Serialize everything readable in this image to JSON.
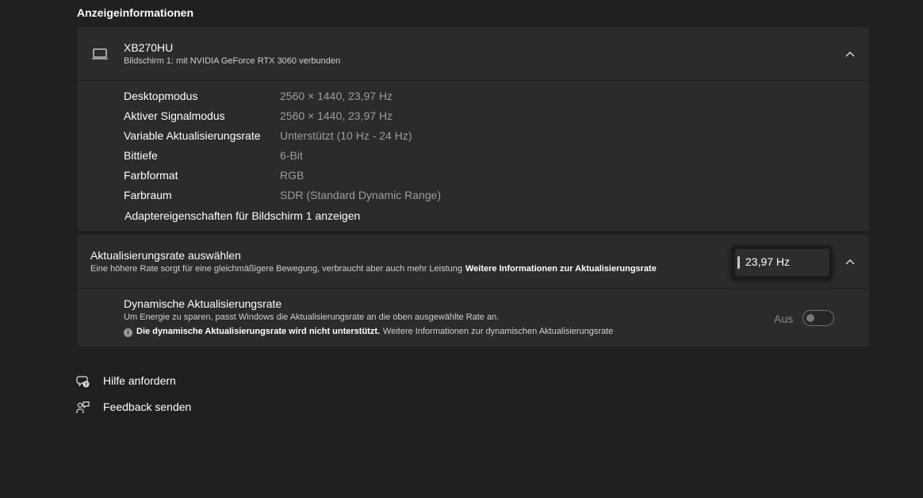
{
  "section_title": "Anzeigeinformationen",
  "display": {
    "name": "XB270HU",
    "subtitle": "Bildschirm 1: mit NVIDIA GeForce RTX 3060 verbunden",
    "icon": "laptop-icon",
    "expanded": true,
    "rows": [
      {
        "label": "Desktopmodus",
        "value": "2560 × 1440, 23,97 Hz"
      },
      {
        "label": "Aktiver Signalmodus",
        "value": "2560 × 1440, 23,97 Hz"
      },
      {
        "label": "Variable Aktualisierungsrate",
        "value": "Unterstützt (10 Hz - 24 Hz)"
      },
      {
        "label": "Bittiefe",
        "value": "6-Bit"
      },
      {
        "label": "Farbformat",
        "value": "RGB"
      },
      {
        "label": "Farbraum",
        "value": "SDR (Standard Dynamic Range)"
      }
    ],
    "adapter_link": "Adaptereigenschaften für Bildschirm 1 anzeigen"
  },
  "refresh_rate": {
    "title": "Aktualisierungsrate auswählen",
    "description": "Eine höhere Rate sorgt für eine gleichmäßigere Bewegung, verbraucht aber auch mehr Leistung",
    "more_info_link": "Weitere Informationen zur Aktualisierungsrate",
    "selected_value": "23,97 Hz",
    "dynamic": {
      "title": "Dynamische Aktualisierungsrate",
      "description": "Um Energie zu sparen, passt Windows die Aktualisierungsrate an die oben ausgewählte Rate an.",
      "note_bold": "Die dynamische Aktualisierungsrate wird nicht unterstützt.",
      "note_link": "Weitere Informationen zur dynamischen Aktualisierungsrate",
      "toggle_label": "Aus",
      "toggle_on": false
    }
  },
  "links": {
    "help": "Hilfe anfordern",
    "feedback": "Feedback senden"
  },
  "colors": {
    "background": "#202020",
    "card": "#2b2b2b",
    "secondary_text": "#9d9d9d"
  }
}
